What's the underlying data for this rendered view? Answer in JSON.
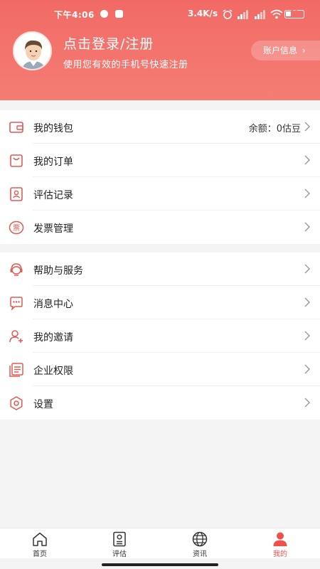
{
  "status_bar": {
    "time": "下午4:06",
    "speed": "3.4K/s",
    "battery": "30",
    "battery_level": 0.3
  },
  "profile": {
    "title": "点击登录/注册",
    "subtitle": "使用您有效的手机号快速注册",
    "account_button": "账户信息",
    "account_chevron": "›"
  },
  "menu_group_1": [
    {
      "id": "wallet",
      "label": "我的钱包",
      "icon": "wallet-icon",
      "extra": "余额：0估豆"
    },
    {
      "id": "orders",
      "label": "我的订单",
      "icon": "order-bag-icon"
    },
    {
      "id": "records",
      "label": "评估记录",
      "icon": "id-card-icon"
    },
    {
      "id": "invoice",
      "label": "发票管理",
      "icon": "invoice-stamp-icon",
      "icon_text": "票"
    }
  ],
  "menu_group_2": [
    {
      "id": "help",
      "label": "帮助与服务",
      "icon": "headset-icon"
    },
    {
      "id": "messages",
      "label": "消息中心",
      "icon": "chat-bubble-icon"
    },
    {
      "id": "invite",
      "label": "我的邀请",
      "icon": "user-add-icon"
    },
    {
      "id": "enterprise",
      "label": "企业权限",
      "icon": "documents-icon"
    },
    {
      "id": "settings",
      "label": "设置",
      "icon": "gear-icon"
    }
  ],
  "tabbar": [
    {
      "label": "首页",
      "icon": "home-icon",
      "active": false
    },
    {
      "label": "评估",
      "icon": "assessment-icon",
      "active": false
    },
    {
      "label": "资讯",
      "icon": "globe-icon",
      "active": false
    },
    {
      "label": "我的",
      "icon": "person-icon",
      "active": true
    }
  ],
  "colors": {
    "accent": "#f0504b",
    "header": "#f36f69",
    "icon": "#e05a55"
  }
}
